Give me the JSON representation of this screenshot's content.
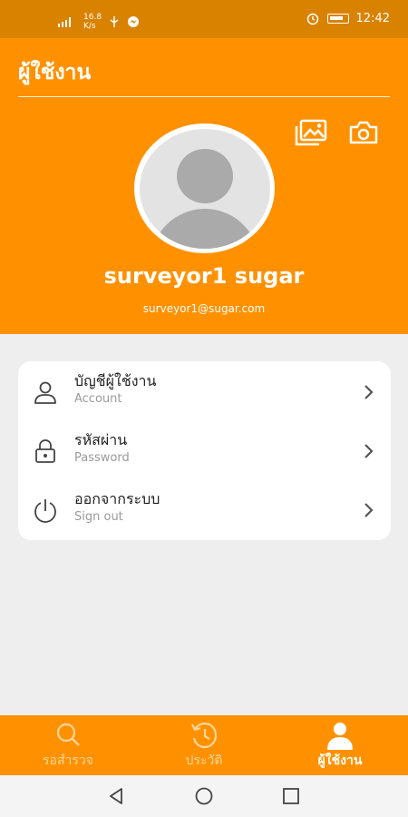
{
  "status_bar": {
    "network_speed_top": "16.8",
    "network_speed_bottom": "K/s",
    "time": "12:42"
  },
  "header": {
    "title": "ผู้ใช้งาน"
  },
  "profile": {
    "name": "surveyor1 sugar",
    "email": "surveyor1@sugar.com"
  },
  "menu": [
    {
      "label_th": "บัญชีผู้ใช้งาน",
      "label_en": "Account",
      "icon": "person-icon"
    },
    {
      "label_th": "รหัสผ่าน",
      "label_en": "Password",
      "icon": "lock-icon"
    },
    {
      "label_th": "ออกจากระบบ",
      "label_en": "Sign out",
      "icon": "power-icon"
    }
  ],
  "bottom_nav": [
    {
      "label": "รอสำรวจ",
      "icon": "search-icon",
      "active": false
    },
    {
      "label": "ประวัติ",
      "icon": "history-icon",
      "active": false
    },
    {
      "label": "ผู้ใช้งาน",
      "icon": "user-icon",
      "active": true
    }
  ],
  "colors": {
    "primary": "#ff9100",
    "status_bar": "#d98200",
    "background": "#eeeeee"
  }
}
